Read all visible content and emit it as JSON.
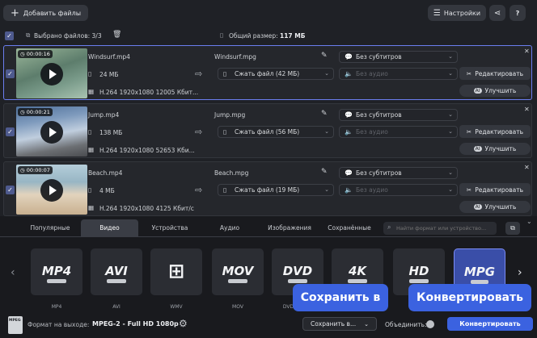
{
  "toolbar": {
    "add_files": "Добавить файлы",
    "settings": "Настройки",
    "help": "?"
  },
  "summary": {
    "selected": "Выбрано файлов: 3/3",
    "total_label": "Общий размер:",
    "total_value": "117 МБ"
  },
  "files": [
    {
      "time": "00:00:16",
      "name": "Windsurf.mp4",
      "size": "24 МБ",
      "codec": "H.264 1920x1080 12005 Кбит...",
      "out_name": "Windsurf.mpg",
      "compress": "Сжать файл (42 МБ)",
      "subs": "Без субтитров",
      "audio": "Без аудио",
      "edit": "Редактировать",
      "enhance": "Улучшить"
    },
    {
      "time": "00:00:21",
      "name": "Jump.mp4",
      "size": "138 МБ",
      "codec": "H.264 1920x1080 52653 Кби...",
      "out_name": "Jump.mpg",
      "compress": "Сжать файл (56 МБ)",
      "subs": "Без субтитров",
      "audio": "Без аудио",
      "edit": "Редактировать",
      "enhance": "Улучшить"
    },
    {
      "time": "00:00:07",
      "name": "Beach.mp4",
      "size": "4 МБ",
      "codec": "H.264 1920x1080 4125 Кбит/с",
      "out_name": "Beach.mpg",
      "compress": "Сжать файл (19 МБ)",
      "subs": "Без субтитров",
      "audio": "Без аудио",
      "edit": "Редактировать",
      "enhance": "Улучшить"
    }
  ],
  "tabs": [
    "Популярные",
    "Видео",
    "Устройства",
    "Аудио",
    "Изображения",
    "Сохранённые"
  ],
  "search_placeholder": "Найти формат или устройство...",
  "formats": [
    {
      "icon": "MP4",
      "label": "MP4"
    },
    {
      "icon": "AVI",
      "label": "AVI"
    },
    {
      "icon": "",
      "label": "WMV"
    },
    {
      "icon": "MOV",
      "label": "MOV"
    },
    {
      "icon": "DVD",
      "label": "DVD-совм..."
    },
    {
      "icon": "4K",
      "label": ""
    },
    {
      "icon": "HD",
      "label": ""
    },
    {
      "icon": "MPG",
      "label": ""
    }
  ],
  "bottom": {
    "format_label": "Формат на выходе:",
    "format_value": "MPEG-2 - Full HD 1080p",
    "save_to": "Сохранить в...",
    "merge": "Объединить:",
    "convert": "Конвертировать"
  },
  "tooltips": {
    "save": "Сохранить в",
    "convert": "Конвертировать"
  }
}
